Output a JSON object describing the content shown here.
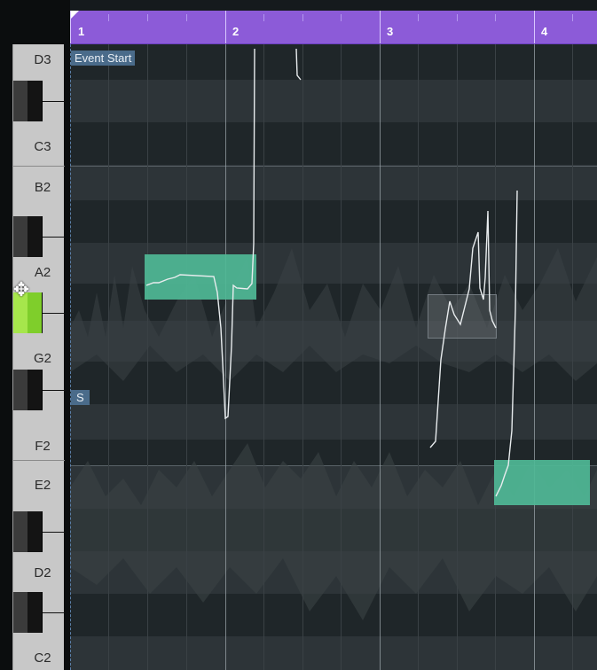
{
  "ruler": {
    "bars": [
      "1",
      "2",
      "3",
      "4"
    ]
  },
  "keyboard": {
    "labels": [
      "D3",
      "C3",
      "B2",
      "A2",
      "G2",
      "F2",
      "E2",
      "D2",
      "C2"
    ],
    "active_key": "G#2"
  },
  "editor": {
    "event_start_label": "Event Start",
    "s_marker": "S"
  },
  "colors": {
    "ruler": "#8c5bd8",
    "note": "#4fb896",
    "active_key": "#7fce2b",
    "label_tag": "#4a6b8a"
  },
  "icons": {
    "cursor": "move-cursor-icon"
  }
}
